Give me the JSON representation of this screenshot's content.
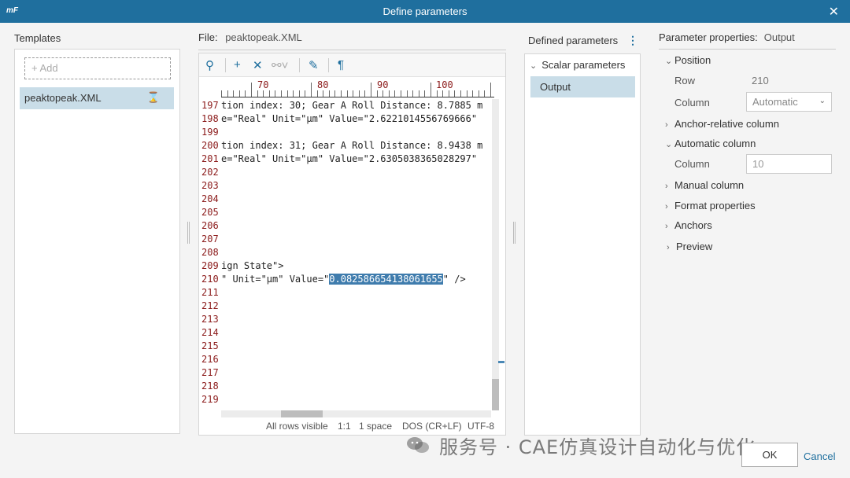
{
  "window": {
    "logo": "mF",
    "title": "Define parameters"
  },
  "templates": {
    "label": "Templates",
    "add_label": "+ Add",
    "items": [
      {
        "name": "peaktopeak.XML",
        "status_icon": "hourglass-icon"
      }
    ]
  },
  "file": {
    "label": "File:",
    "name": "peaktopeak.XML"
  },
  "toolbar": {
    "icons": [
      "search-icon",
      "add-icon",
      "delete-icon",
      "link-icon",
      "edit-icon",
      "pilcrow-icon"
    ]
  },
  "ruler": {
    "marks": [
      "70",
      "80",
      "90",
      "100"
    ]
  },
  "code_lines": [
    {
      "num": "197",
      "text": "tion index: 30; Gear A Roll Distance: 8.7885 m"
    },
    {
      "num": "198",
      "text": "e=\"Real\" Unit=\"µm\" Value=\"2.6221014556769666\""
    },
    {
      "num": "199",
      "text": ""
    },
    {
      "num": "200",
      "text": "tion index: 31; Gear A Roll Distance: 8.9438 m"
    },
    {
      "num": "201",
      "text": "e=\"Real\" Unit=\"µm\" Value=\"2.6305038365028297\""
    },
    {
      "num": "202",
      "text": ""
    },
    {
      "num": "203",
      "text": ""
    },
    {
      "num": "204",
      "text": ""
    },
    {
      "num": "205",
      "text": ""
    },
    {
      "num": "206",
      "text": ""
    },
    {
      "num": "207",
      "text": ""
    },
    {
      "num": "208",
      "text": ""
    },
    {
      "num": "209",
      "text": "ign State\">"
    },
    {
      "num": "210",
      "text_before": "\" Unit=\"µm\" Value=\"",
      "text_selected": "0.082586654138061655",
      "text_after": "\" />"
    },
    {
      "num": "211",
      "text": ""
    },
    {
      "num": "212",
      "text": ""
    },
    {
      "num": "213",
      "text": ""
    },
    {
      "num": "214",
      "text": ""
    },
    {
      "num": "215",
      "text": ""
    },
    {
      "num": "216",
      "text": ""
    },
    {
      "num": "217",
      "text": ""
    },
    {
      "num": "218",
      "text": ""
    },
    {
      "num": "219",
      "text": ""
    }
  ],
  "statusbar": {
    "rows": "All rows visible",
    "position": "1:1",
    "indent": "1 space",
    "line_endings": "DOS (CR+LF)",
    "encoding": "UTF-8"
  },
  "defined": {
    "label": "Defined parameters",
    "menu_icon": "more-vertical-icon",
    "group": "Scalar parameters",
    "items": [
      "Output"
    ]
  },
  "props": {
    "label": "Parameter properties:",
    "selected": "Output",
    "position_label": "Position",
    "row_label": "Row",
    "row_value": "210",
    "column_label": "Column",
    "column_select": "Automatic",
    "anchor_relative_label": "Anchor-relative column",
    "automatic_column_label": "Automatic column",
    "auto_column_label": "Column",
    "auto_column_value": "10",
    "manual_column_label": "Manual column",
    "format_label": "Format properties",
    "anchors_label": "Anchors",
    "preview_label": "Preview"
  },
  "buttons": {
    "ok": "OK",
    "cancel": "Cancel"
  },
  "watermark": {
    "text": "服务号 · CAE仿真设计自动化与优化"
  },
  "colors": {
    "titlebar": "#1f6f9e",
    "selection": "#3f7cad",
    "selected_item": "#c9dde8",
    "line_number": "#8b1a1a"
  }
}
